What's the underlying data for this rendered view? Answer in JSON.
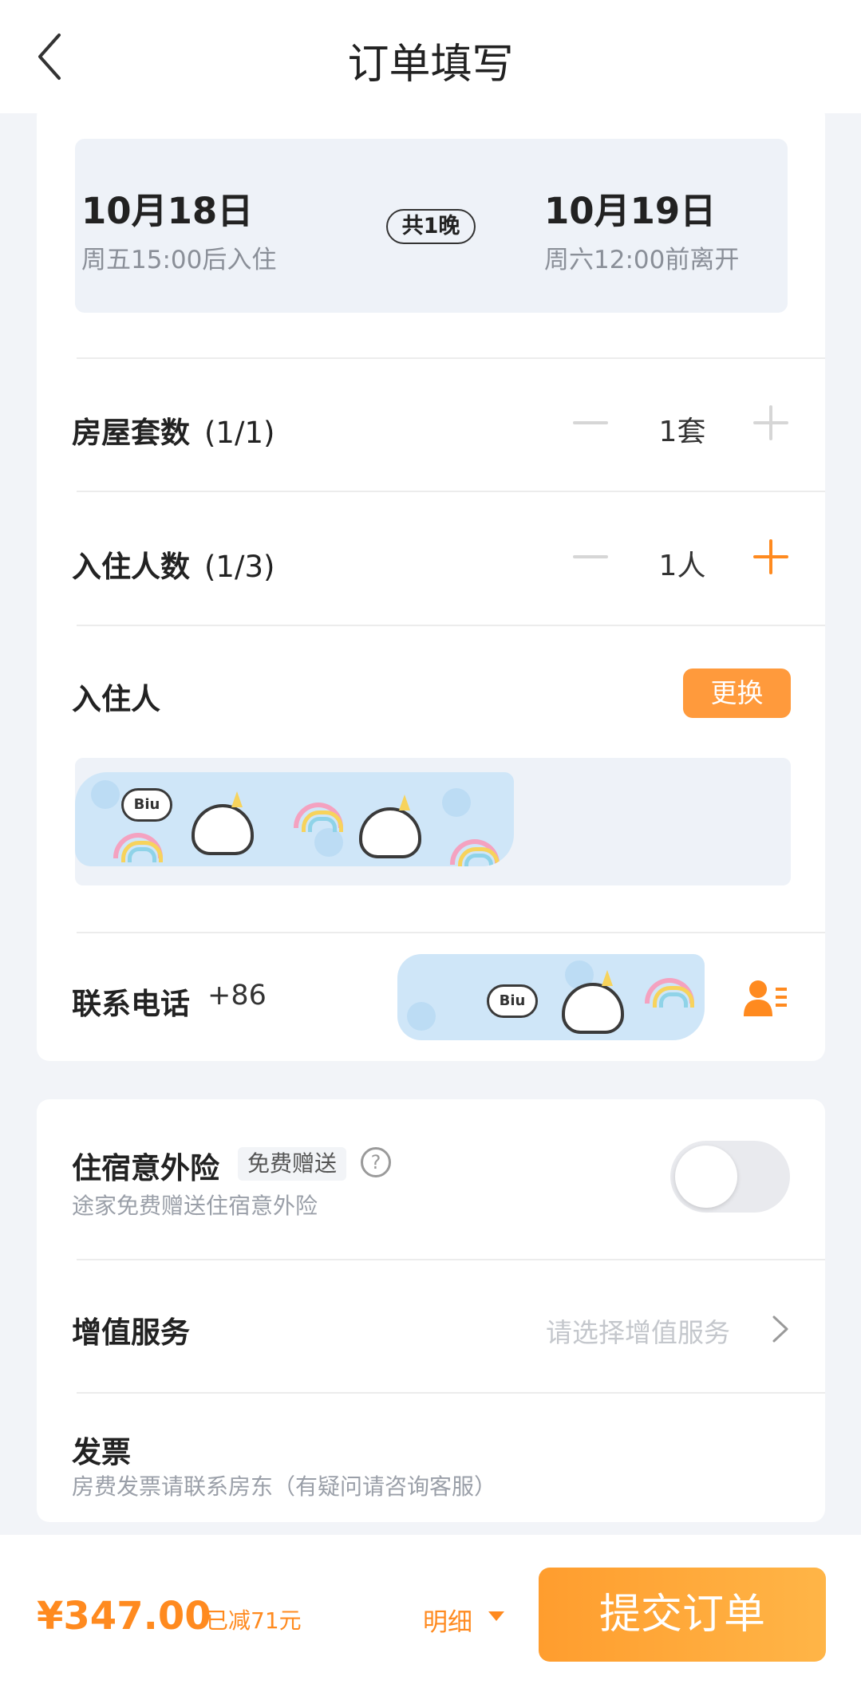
{
  "header": {
    "title": "订单填写"
  },
  "stay": {
    "checkin_date": "10月18日",
    "checkin_note": "周五15:00后入住",
    "nights": "共1晚",
    "checkout_date": "10月19日",
    "checkout_note": "周六12:00前离开"
  },
  "rooms": {
    "label": "房屋套数",
    "fraction": "(1/1)",
    "value": "1套"
  },
  "guests": {
    "label": "入住人数",
    "fraction": "(1/3)",
    "value": "1人"
  },
  "occupant": {
    "label": "入住人",
    "change_label": "更换"
  },
  "contact": {
    "label": "联系电话",
    "code": "+86"
  },
  "insurance": {
    "label": "住宿意外险",
    "tag": "免费赠送",
    "help": "?",
    "note": "途家免费赠送住宿意外险",
    "enabled": false
  },
  "services": {
    "label": "增值服务",
    "placeholder": "请选择增值服务"
  },
  "invoice": {
    "label": "发票",
    "note": "房费发票请联系房东（有疑问请咨询客服）"
  },
  "footer": {
    "price": "¥347.00",
    "discount": "已减71元",
    "detail_label": "明细",
    "submit_label": "提交订单"
  },
  "colors": {
    "accent": "#ff8a1f",
    "button": "#ff9a3c"
  }
}
